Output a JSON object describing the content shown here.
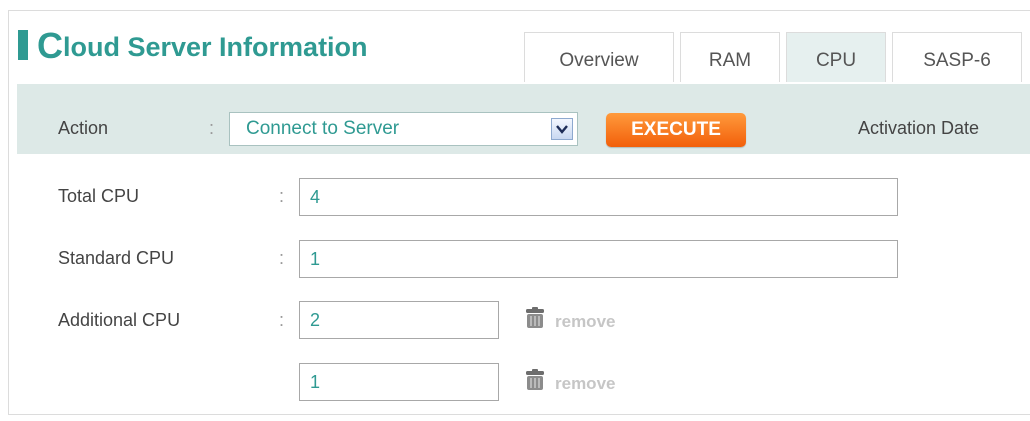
{
  "header": {
    "title_first": "C",
    "title_rest": "loud Server Information"
  },
  "tabs": [
    {
      "label": "Overview",
      "active": false
    },
    {
      "label": "RAM",
      "active": false
    },
    {
      "label": "CPU",
      "active": true
    },
    {
      "label": "SASP-6",
      "active": false
    }
  ],
  "action": {
    "label": "Action",
    "colon": ":",
    "selected": "Connect to Server",
    "execute_label": "EXECUTE",
    "activation_label": "Activation Date"
  },
  "cpu": {
    "colon": ":",
    "total_label": "Total CPU",
    "total_value": "4",
    "standard_label": "Standard CPU",
    "standard_value": "1",
    "additional_label": "Additional CPU",
    "additional": [
      {
        "value": "2",
        "remove_label": "remove"
      },
      {
        "value": "1",
        "remove_label": "remove"
      }
    ]
  },
  "icons": {
    "trash": "trash-icon",
    "dropdown": "chevron-down-icon"
  },
  "colors": {
    "accent": "#2f9a92",
    "execute": "#f57920",
    "actionbar": "#dde9e7"
  }
}
